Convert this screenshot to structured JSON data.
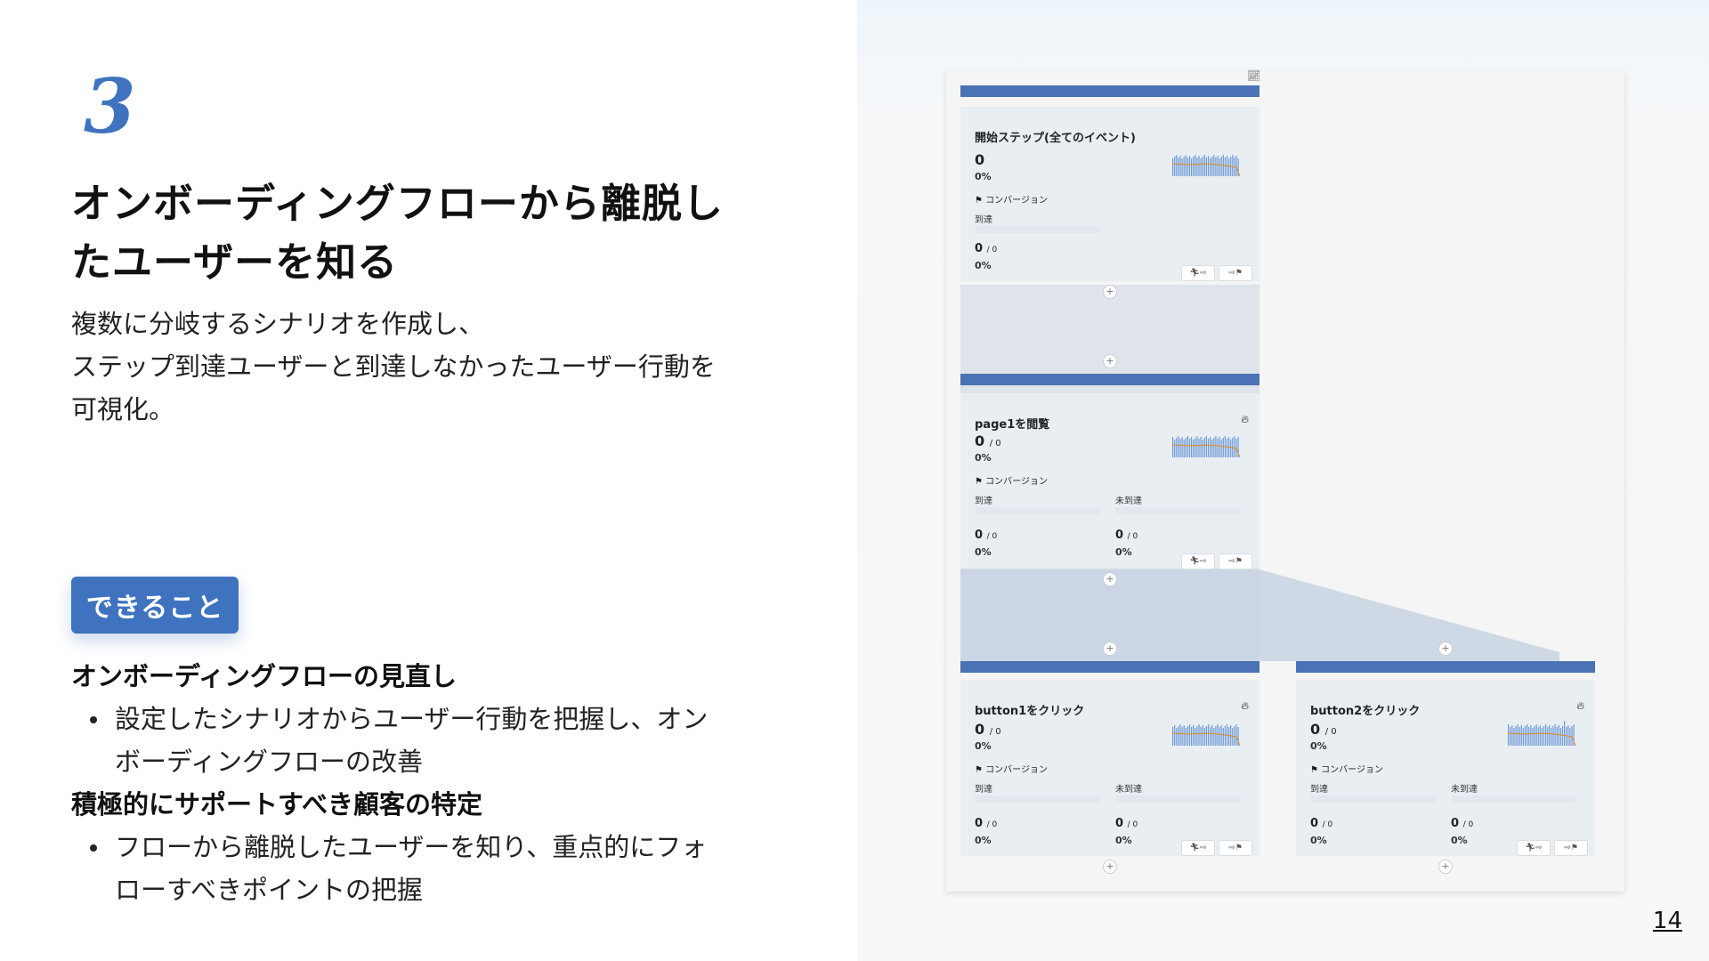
{
  "slide": {
    "step_number": "3",
    "title_line1": "オンボーディングフローから離脱し",
    "title_line2": "たユーザーを知る",
    "desc_line1": "複数に分岐するシナリオを作成し、",
    "desc_line2": "ステップ到達ユーザーと到達しなかったユーザー行動を",
    "desc_line3": "可視化。",
    "badge": "できること",
    "point1_head": "オンボーディングフローの見直し",
    "point1_item_line1": "設定したシナリオからユーザー行動を把握し、オン",
    "point1_item_line2": "ボーディングフローの改善",
    "point2_head": "積極的にサポートすべき顧客の特定",
    "point2_item_line1": "フローから離脱したユーザーを知り、重点的にフォ",
    "point2_item_line2": "ローすべきポイントの把握",
    "page_number": "14"
  },
  "screenshot": {
    "chart_icon": "line-chart-icon",
    "conversion_label": "コンバージョン",
    "reached_label": "到達",
    "not_reached_label": "未到達",
    "icons": [
      "flag-icon",
      "flame-icon",
      "runner-icon",
      "arrow-icon",
      "plus-icon"
    ],
    "cards": [
      {
        "name": "開始ステップ(全てのイベント)",
        "count": "0",
        "pct": "0%",
        "reached_count": "0",
        "reached_total": "/ 0",
        "reached_pct": "0%"
      },
      {
        "name": "page1を閲覧",
        "count": "0",
        "count_total": "/ 0",
        "pct": "0%",
        "reached_count": "0",
        "reached_total": "/ 0",
        "reached_pct": "0%",
        "not_count": "0",
        "not_total": "/ 0",
        "not_pct": "0%"
      },
      {
        "name": "button1をクリック",
        "count": "0",
        "count_total": "/ 0",
        "pct": "0%",
        "reached_count": "0",
        "reached_total": "/ 0",
        "reached_pct": "0%",
        "not_count": "0",
        "not_total": "/ 0",
        "not_pct": "0%"
      },
      {
        "name": "button2をクリック",
        "count": "0",
        "count_total": "/ 0",
        "pct": "0%",
        "reached_count": "0",
        "reached_total": "/ 0",
        "reached_pct": "0%",
        "not_count": "0",
        "not_total": "/ 0",
        "not_pct": "0%"
      }
    ],
    "colors": {
      "accent": "#3f73c0",
      "bar": "#4a72b4",
      "card": "#e9eef3",
      "spark_bar": "#6f9ad6",
      "spark_line": "#e08a1e"
    }
  }
}
